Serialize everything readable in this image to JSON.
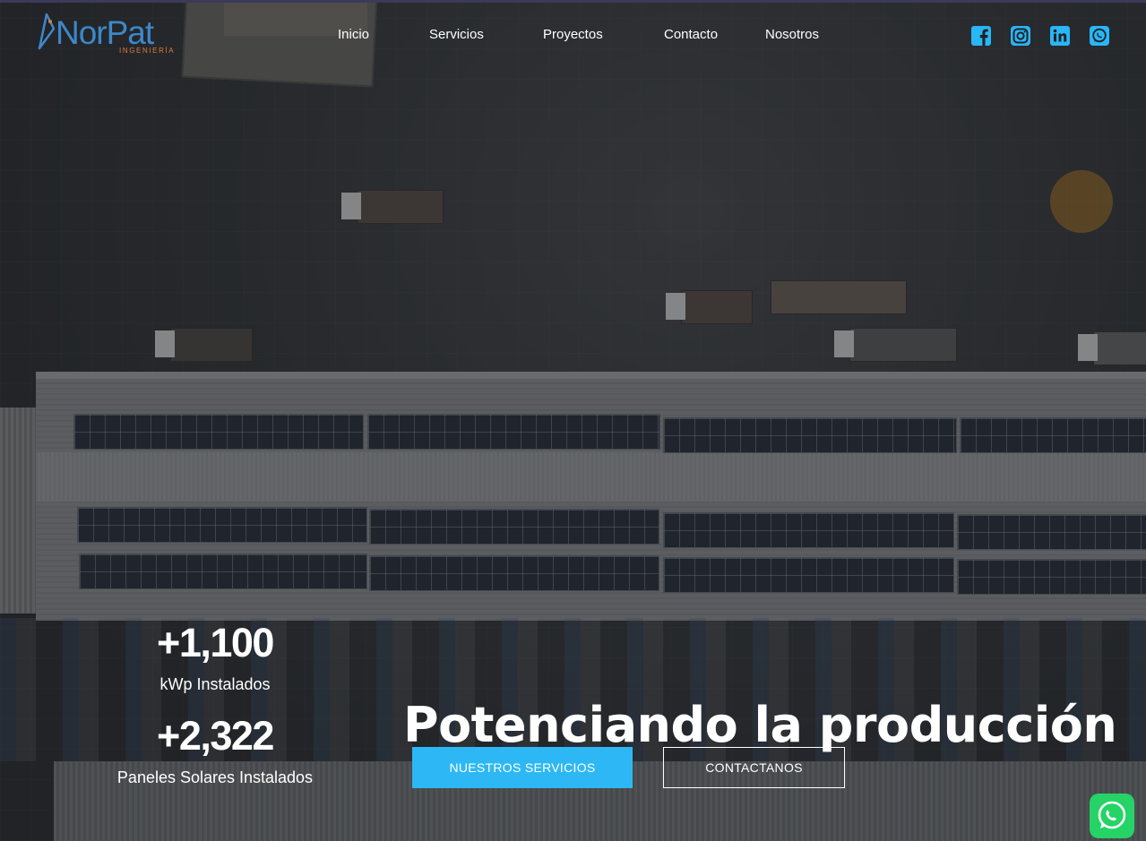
{
  "brand": {
    "name": "NorPat",
    "tagline": "INGENIERÍA",
    "logo_color": "#3d88c9",
    "tagline_color": "#e07b39"
  },
  "nav": {
    "items": [
      "Inicio",
      "Servicios",
      "Proyectos",
      "Contacto",
      "Nosotros"
    ]
  },
  "social": {
    "color": "#29b6f6",
    "icons": [
      "facebook-icon",
      "instagram-icon",
      "linkedin-icon",
      "whatsapp-icon"
    ]
  },
  "stats": [
    {
      "value": "+1,100",
      "label": "kWp Instalados"
    },
    {
      "value": "+2,322",
      "label": "Paneles Solares Instalados"
    }
  ],
  "hero": {
    "headline": "Potenciando la producción",
    "primary_button": "NUESTROS SERVICIOS",
    "secondary_button": "CONTACTANOS",
    "accent": "#2db8f5"
  },
  "floating": {
    "icon": "whatsapp-icon",
    "color": "#25d366"
  }
}
